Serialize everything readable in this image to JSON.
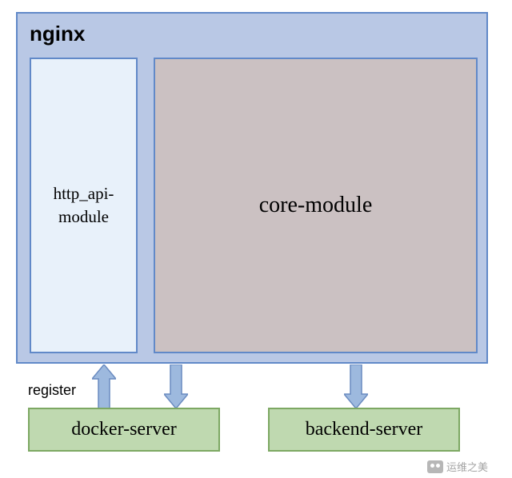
{
  "container": {
    "title": "nginx"
  },
  "modules": {
    "http_api": "http_api-module",
    "core": "core-module"
  },
  "arrows": {
    "register_label": "register"
  },
  "servers": {
    "docker": "docker-server",
    "backend": "backend-server"
  },
  "watermark": {
    "text": "运维之美"
  },
  "colors": {
    "container_bg": "#b9c8e5",
    "container_border": "#6189c8",
    "light_box_bg": "#e8f1fa",
    "gray_box_bg": "#cbc1c2",
    "server_bg": "#bfd9b0",
    "server_border": "#7da863",
    "arrow_fill": "#9db9de",
    "arrow_stroke": "#6a8bc0"
  }
}
